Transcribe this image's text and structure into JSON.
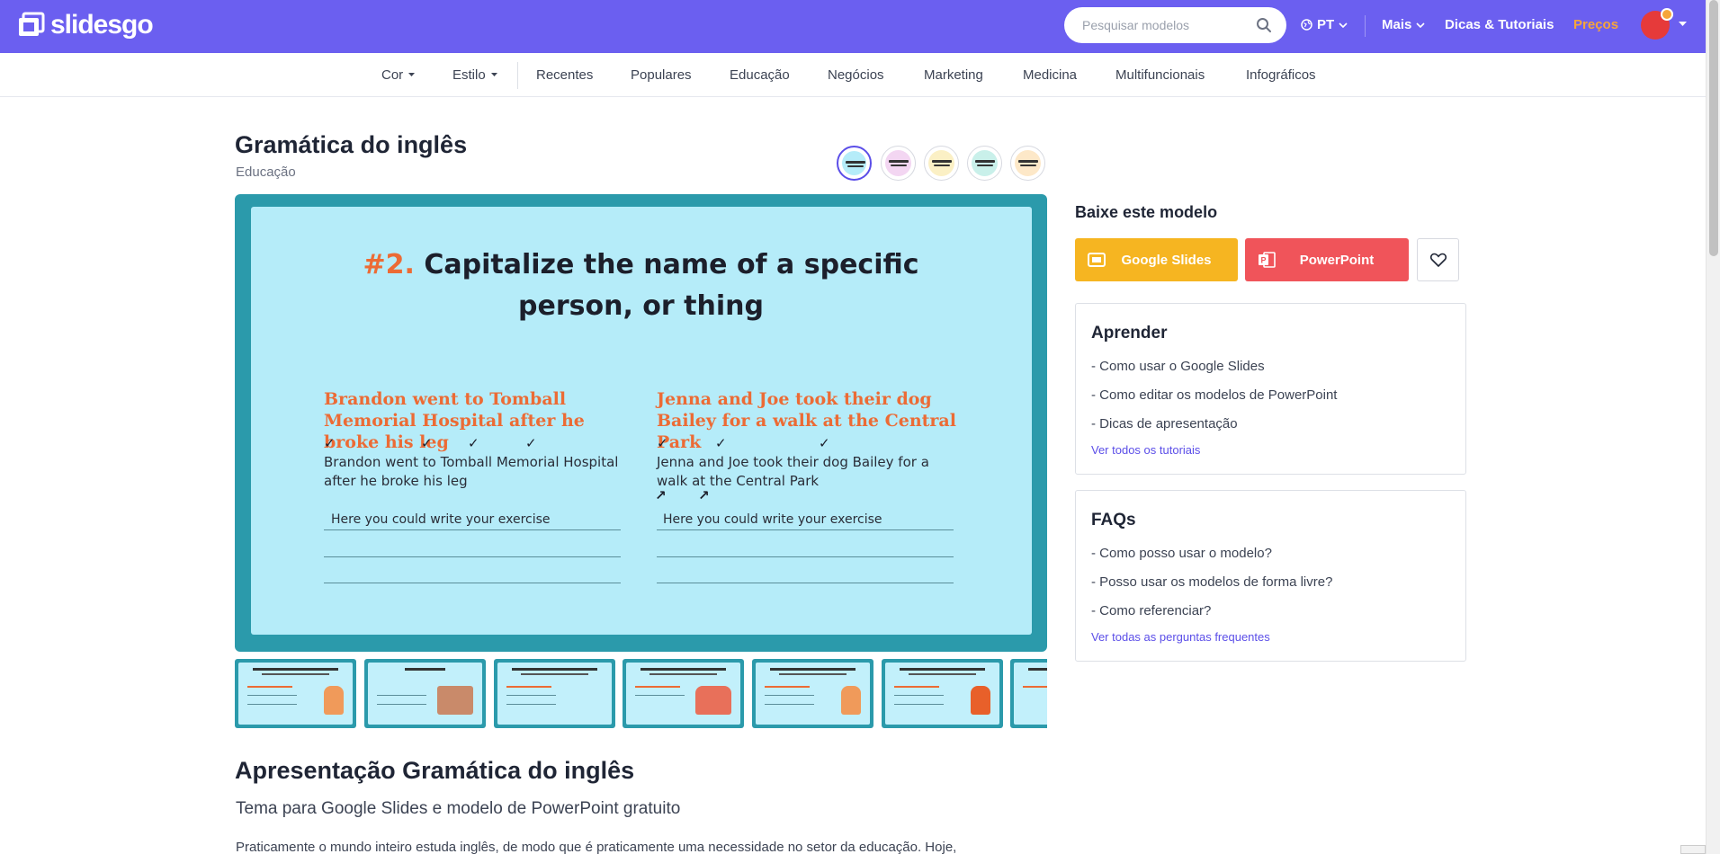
{
  "header": {
    "logo_text": "slidesgo",
    "search_placeholder": "Pesquisar modelos",
    "language": "PT",
    "more": "Mais",
    "tips": "Dicas & Tutoriais",
    "pricing": "Preços",
    "brand_color": "#6b5ff0",
    "pricing_color": "#f6a53a"
  },
  "categories": {
    "cor": "Cor",
    "estilo": "Estilo",
    "items": [
      "Recentes",
      "Populares",
      "Educação",
      "Negócios",
      "Marketing",
      "Medicina",
      "Multifuncionais",
      "Infográficos"
    ]
  },
  "template": {
    "title": "Gramática do inglês",
    "category": "Educação"
  },
  "slide": {
    "number": "#2.",
    "heading_line1": "Capitalize the name of a specific",
    "heading_line2": "person, or thing",
    "left_heading": "Brandon went to Tomball Memorial Hospital after he broke his leg",
    "left_text": "Brandon went to Tomball Memorial Hospital after he broke his leg",
    "left_exercise": "Here you could write your exercise",
    "right_heading": "Jenna and Joe took their dog Bailey for a walk at the Central Park",
    "right_text": "Jenna and Joe took their dog Bailey for a walk at the Central Park",
    "right_exercise": "Here you could write your exercise",
    "accent_color": "#ec6b35",
    "frame_color": "#2b9aab",
    "bg_color": "#b5ecf9"
  },
  "description": {
    "heading": "Apresentação Gramática do inglês",
    "subheading": "Tema para Google Slides e modelo de PowerPoint gratuito",
    "paragraph": "Praticamente o mundo inteiro estuda inglês, de modo que é praticamente uma necessidade no setor da educação. Hoje,"
  },
  "download": {
    "title": "Baixe este modelo",
    "google_slides": "Google Slides",
    "powerpoint": "PowerPoint",
    "gs_color": "#f6b521",
    "pp_color": "#f0545a"
  },
  "learn": {
    "title": "Aprender",
    "links": [
      "- Como usar o Google Slides",
      "- Como editar os modelos de PowerPoint",
      "- Dicas de apresentação"
    ],
    "more": "Ver todos os tutoriais"
  },
  "faqs": {
    "title": "FAQs",
    "links": [
      "- Como posso usar o modelo?",
      "- Posso usar os modelos de forma livre?",
      "- Como referenciar?"
    ],
    "more": "Ver todas as perguntas frequentes"
  }
}
